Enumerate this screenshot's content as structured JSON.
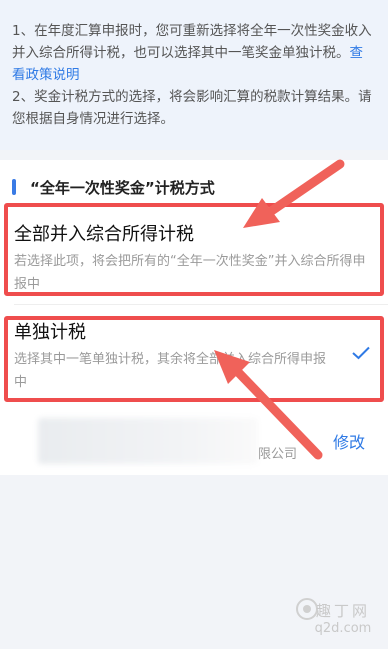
{
  "notice": {
    "line1": "1、在年度汇算申报时，您可重新选择将全年一次性奖金收入并入综合所得计税，也可以选择其中一笔奖金单独计税。",
    "policy_link": "查看政策说明",
    "line2": "2、奖金计税方式的选择，将会影响汇算的税款计算结果。请您根据自身情况进行选择。"
  },
  "section": {
    "title": "“全年一次性奖金”计税方式"
  },
  "options": [
    {
      "title": "全部并入综合所得计税",
      "desc": "若选择此项，将会把所有的“全年一次性奖金”并入综合所得申报中",
      "selected": false
    },
    {
      "title": "单独计税",
      "desc": "选择其中一笔单独计税，其余将全部并入综合所得申报中",
      "selected": true
    }
  ],
  "record": {
    "company_suffix": "限公司",
    "modify_label": "修改"
  },
  "watermark": {
    "title": "趣丁网",
    "site": "q2d.com"
  },
  "colors": {
    "accent": "#2f7ae5",
    "highlight": "#ef4d4d"
  }
}
